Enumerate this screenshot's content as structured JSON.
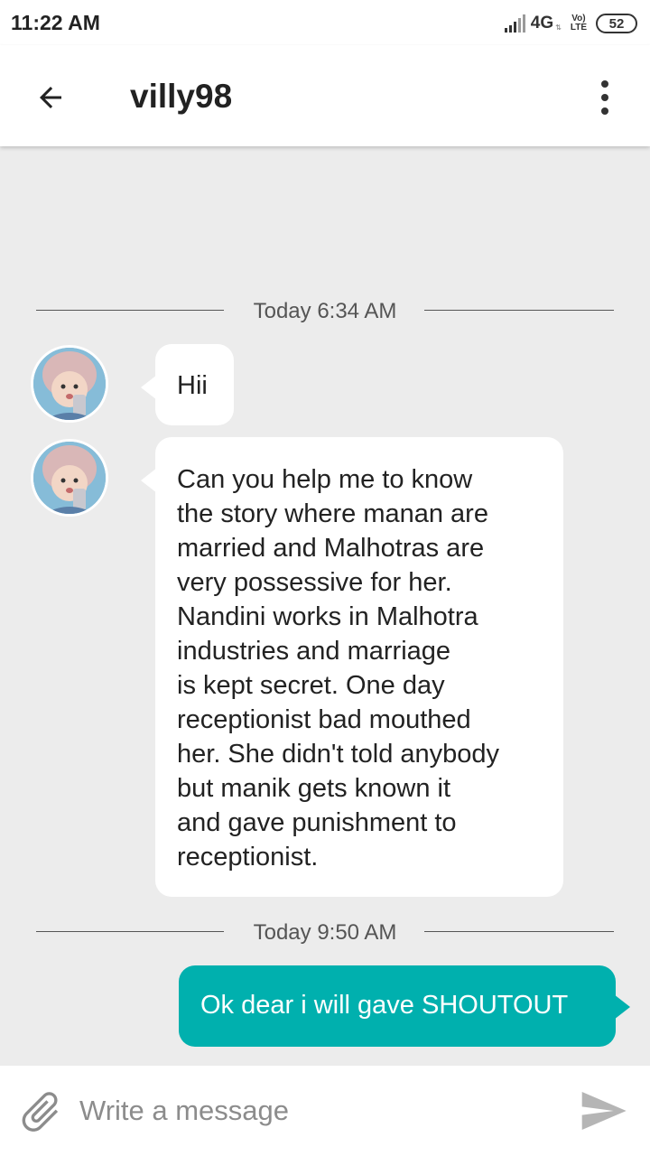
{
  "status_bar": {
    "time": "11:22 AM",
    "network": "4G",
    "volte_top": "Vo)",
    "volte_bottom": "LTE",
    "battery": "52"
  },
  "header": {
    "title": "villy98",
    "back_icon": "arrow-left-icon",
    "menu_icon": "more-vertical-icon"
  },
  "conversation": {
    "dividers": [
      {
        "label": "Today 6:34 AM"
      },
      {
        "label": "Today 9:50 AM"
      }
    ],
    "incoming": [
      {
        "text": "Hii"
      },
      {
        "lines": [
          "Can you help me to know",
          "the story where manan are",
          "married and Malhotras are",
          "very possessive for her.",
          "Nandini works in Malhotra",
          "industries and marriage",
          "is kept secret. One day",
          "receptionist bad mouthed",
          "her. She didn't told anybody",
          "but manik gets known it",
          "and gave punishment to",
          "receptionist."
        ]
      }
    ],
    "outgoing": [
      {
        "text": "Ok dear i will gave SHOUTOUT"
      }
    ]
  },
  "composer": {
    "placeholder": "Write a message",
    "value": "",
    "attach_icon": "paperclip-icon",
    "send_icon": "send-icon"
  },
  "colors": {
    "accent": "#00b0ae",
    "background": "#ececec",
    "bubble_incoming": "#ffffff"
  }
}
